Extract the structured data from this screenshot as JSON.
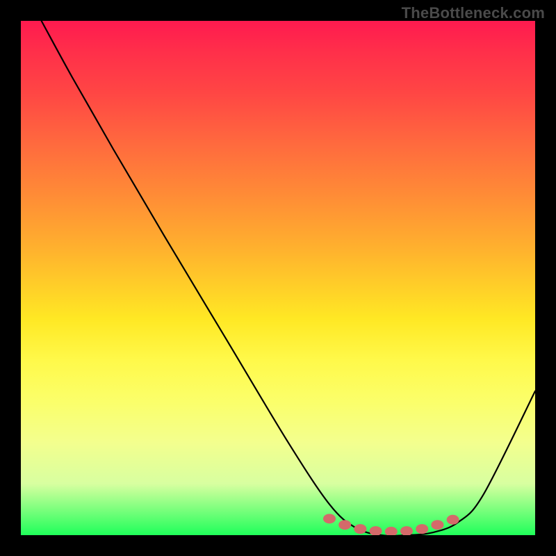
{
  "watermark": "TheBottleneck.com",
  "chart_data": {
    "type": "line",
    "title": "",
    "xlabel": "",
    "ylabel": "",
    "xlim": [
      0,
      100
    ],
    "ylim": [
      0,
      100
    ],
    "gradient_stops": [
      {
        "pct": 0,
        "color": "#ff1a4f"
      },
      {
        "pct": 6,
        "color": "#ff2f4a"
      },
      {
        "pct": 14,
        "color": "#ff4644"
      },
      {
        "pct": 24,
        "color": "#ff6a3e"
      },
      {
        "pct": 34,
        "color": "#ff8c36"
      },
      {
        "pct": 44,
        "color": "#ffb02e"
      },
      {
        "pct": 52,
        "color": "#ffd028"
      },
      {
        "pct": 58,
        "color": "#ffe824"
      },
      {
        "pct": 66,
        "color": "#fff94a"
      },
      {
        "pct": 74,
        "color": "#fbff6a"
      },
      {
        "pct": 82,
        "color": "#f3ff8e"
      },
      {
        "pct": 90,
        "color": "#d8ffa0"
      },
      {
        "pct": 100,
        "color": "#1fff5a"
      }
    ],
    "series": [
      {
        "name": "bottleneck-curve",
        "x": [
          4,
          10,
          18,
          28,
          40,
          52,
          60,
          65,
          70,
          75,
          80,
          85,
          90,
          100
        ],
        "y": [
          100,
          89,
          75,
          58,
          38,
          18,
          6,
          1.5,
          0,
          0,
          0.5,
          2.5,
          8,
          28
        ]
      }
    ],
    "markers": {
      "name": "optimal-range-dots",
      "color": "#d46a6a",
      "points": [
        {
          "x": 60,
          "y": 3.2
        },
        {
          "x": 63,
          "y": 2.0
        },
        {
          "x": 66,
          "y": 1.2
        },
        {
          "x": 69,
          "y": 0.8
        },
        {
          "x": 72,
          "y": 0.7
        },
        {
          "x": 75,
          "y": 0.8
        },
        {
          "x": 78,
          "y": 1.2
        },
        {
          "x": 81,
          "y": 2.0
        },
        {
          "x": 84,
          "y": 3.0
        }
      ]
    }
  }
}
